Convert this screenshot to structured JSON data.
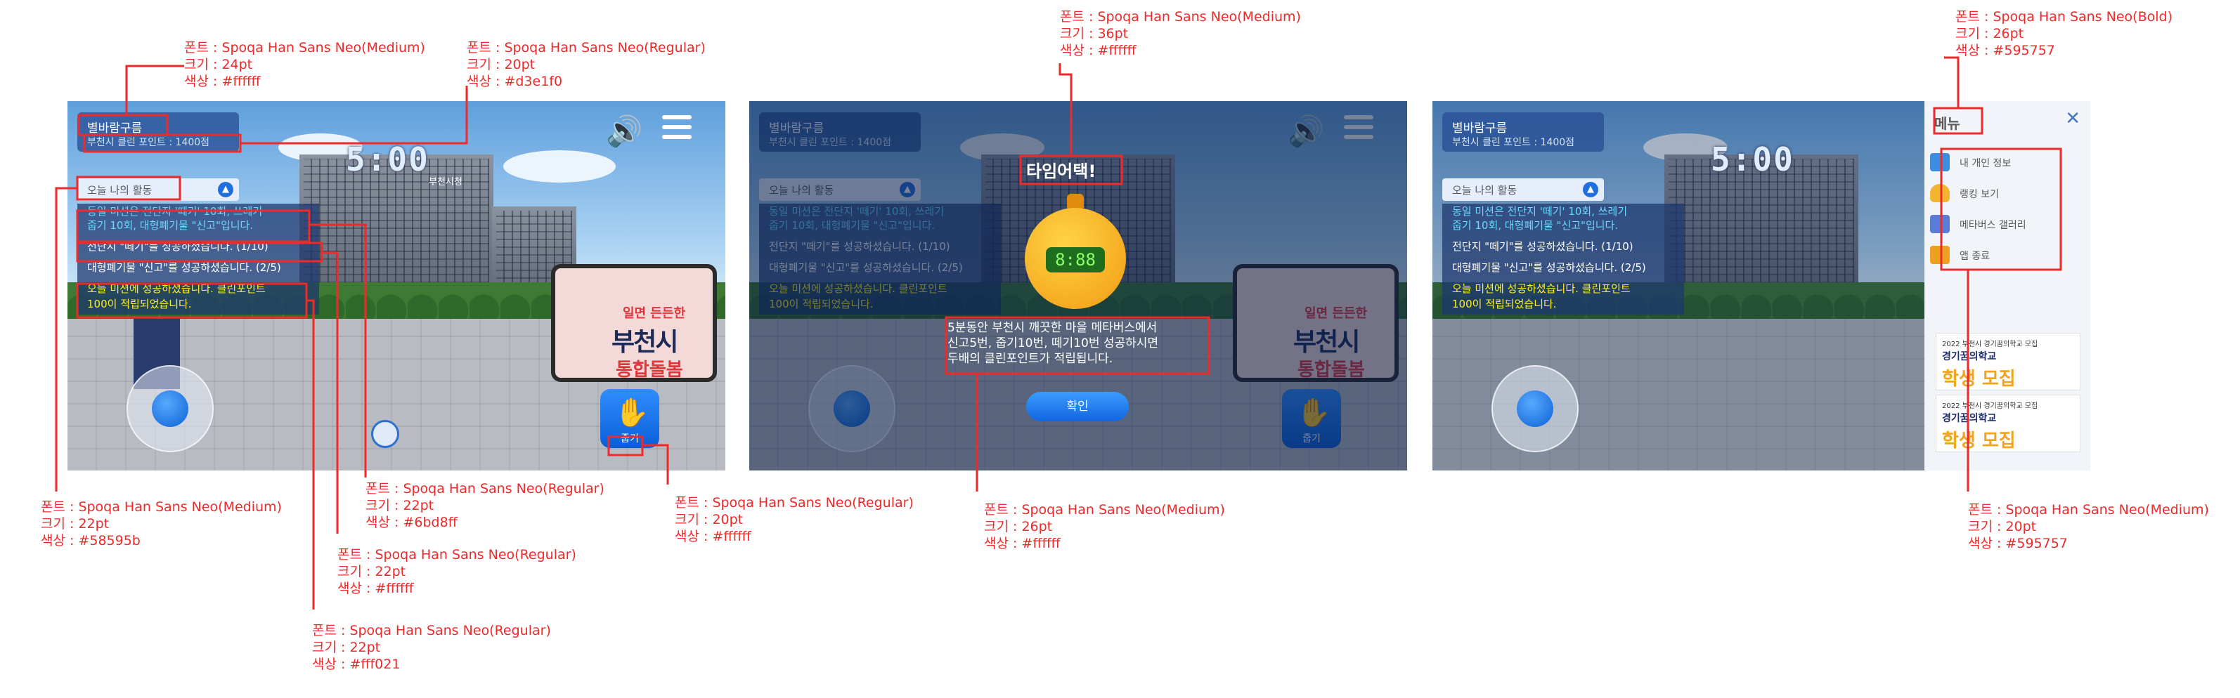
{
  "screens": {
    "hud": {
      "user_name": "별바람구름",
      "clean_points": "부천시 클린 포인트 : 1400점",
      "timer": "5:00",
      "timer_location": "부천시청",
      "activity_title": "오늘 나의 활동",
      "activity_lines": [
        {
          "text": "동일 미션은 전단지 '떼기' 10회, 쓰레기",
          "color": "#6bd8ff"
        },
        {
          "text": "줍기 10회, 대형폐기물 \"신고\"입니다.",
          "color": "#6bd8ff"
        },
        {
          "text": "전단지 \"떼기\"를 성공하셨습니다. (1/10)",
          "color": "#ffffff"
        },
        {
          "text": "대형폐기물 \"신고\"를 성공하셨습니다. (2/5)",
          "color": "#ffffff"
        },
        {
          "text": "오늘 미션에 성공하셨습니다. 클린포인트",
          "color": "#fff021"
        },
        {
          "text": "100이 적립되었습니다.",
          "color": "#fff021"
        }
      ],
      "pickup_label": "줍기",
      "board": {
        "line1": "일면 든든한",
        "line2": "부천시",
        "line3": "통합돌봄"
      },
      "colors": {
        "highlight_blue": "#6bd8ff",
        "success_yellow": "#fff021"
      }
    },
    "popup": {
      "title": "타임어택!",
      "watch_display": "8:88",
      "message_lines": [
        "5분동안 부천시 깨끗한 마을 메타버스에서",
        "신고5번, 줍기10번, 떼기10번 성공하시면",
        "두배의 클린포인트가 적립됩니다."
      ],
      "confirm_label": "확인"
    },
    "menu": {
      "title": "메뉴",
      "close_icon": "close-icon",
      "items": [
        {
          "label": "내 개인 정보",
          "icon": "id-card-icon",
          "color": "#3c8ddf"
        },
        {
          "label": "랭킹 보기",
          "icon": "trophy-icon",
          "color": "#f2b530"
        },
        {
          "label": "메타버스 갤러리",
          "icon": "gallery-icon",
          "color": "#5a7bd6"
        },
        {
          "label": "앱 종료",
          "icon": "exit-icon",
          "color": "#f0a020"
        }
      ],
      "ads": [
        {
          "line1": "2022 부천시 경기꿈의학교 모집",
          "line2": "경기꿈의학교",
          "line3": "학생 모집"
        },
        {
          "line1": "2022 부천시 경기꿈의학교 모집",
          "line2": "경기꿈의학교",
          "line3": "학생 모집"
        }
      ]
    }
  },
  "annotations": {
    "name": [
      "폰트 : Spoqa Han Sans Neo(Medium)",
      "크기 : 24pt",
      "색상 : #ffffff"
    ],
    "points": [
      "폰트 : Spoqa Han Sans Neo(Regular)",
      "크기 : 20pt",
      "색상 : #d3e1f0"
    ],
    "activity_title": [
      "폰트 : Spoqa Han Sans Neo(Medium)",
      "크기 : 22pt",
      "색상 : #58595b"
    ],
    "activity_blue": [
      "폰트 : Spoqa Han Sans Neo(Regular)",
      "크기 : 22pt",
      "색상 : #6bd8ff"
    ],
    "activity_white": [
      "폰트 : Spoqa Han Sans Neo(Regular)",
      "크기 : 22pt",
      "색상 : #ffffff"
    ],
    "activity_yellow": [
      "폰트 : Spoqa Han Sans Neo(Regular)",
      "크기 : 22pt",
      "색상 : #fff021"
    ],
    "pickup": [
      "폰트 : Spoqa Han Sans Neo(Regular)",
      "크기 : 20pt",
      "색상 : #ffffff"
    ],
    "popup_title": [
      "폰트 : Spoqa Han Sans Neo(Medium)",
      "크기 : 36pt",
      "색상 : #ffffff"
    ],
    "popup_message": [
      "폰트 : Spoqa Han Sans Neo(Medium)",
      "크기 : 26pt",
      "색상 : #ffffff"
    ],
    "menu_title": [
      "폰트 : Spoqa Han Sans Neo(Bold)",
      "크기 : 26pt",
      "색상 : #595757"
    ],
    "menu_items": [
      "폰트 : Spoqa Han Sans Neo(Medium)",
      "크기 : 20pt",
      "색상 : #595757"
    ]
  },
  "annotation_color": "#ee2a2a"
}
